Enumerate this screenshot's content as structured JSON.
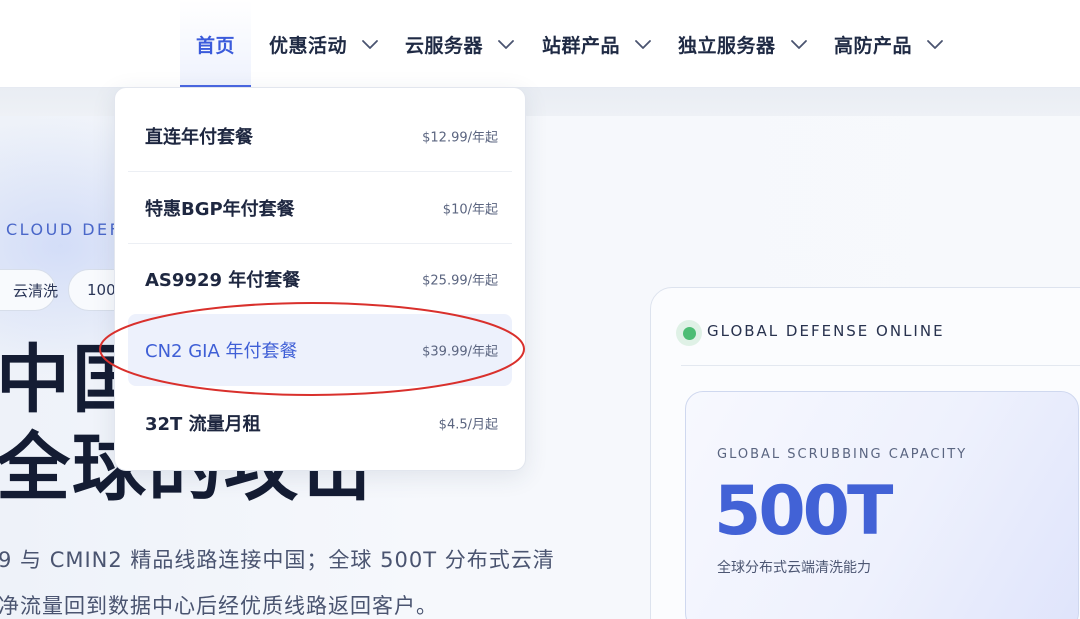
{
  "nav": {
    "items": [
      {
        "label": "首页",
        "has_dropdown": false,
        "active": true
      },
      {
        "label": "优惠活动",
        "has_dropdown": true
      },
      {
        "label": "云服务器",
        "has_dropdown": true
      },
      {
        "label": "站群产品",
        "has_dropdown": true
      },
      {
        "label": "独立服务器",
        "has_dropdown": true
      },
      {
        "label": "高防产品",
        "has_dropdown": true
      }
    ]
  },
  "dropdown": {
    "items": [
      {
        "label": "直连年付套餐",
        "price": "$12.99/年起"
      },
      {
        "label": "特惠BGP年付套餐",
        "price": "$10/年起"
      },
      {
        "label": "AS9929 年付套餐",
        "price": "$25.99/年起"
      },
      {
        "label": "CN2 GIA 年付套餐",
        "price": "$39.99/年起",
        "highlighted": true
      },
      {
        "label": "32T 流量月租",
        "price": "$4.5/月起"
      }
    ]
  },
  "hero": {
    "eyebrow": "CLOUD DEF",
    "pills": [
      "云清洗",
      "100"
    ],
    "title_line1": "中国",
    "title_line2": "全球的攻击",
    "desc_line1": "9 与 CMIN2 精品线路连接中国；全球 500T 分布式云清",
    "desc_line2": "净流量回到数据中心后经优质线路返回客户。"
  },
  "status_card": {
    "status_text": "GLOBAL DEFENSE ONLINE",
    "status_color": "#4cbd74",
    "capacity_label": "GLOBAL SCRUBBING CAPACITY",
    "capacity_value": "500T",
    "capacity_sub": "全球分布式云端清洗能力"
  },
  "colors": {
    "accent": "#3b5bdb",
    "annotation": "#d9302c"
  }
}
